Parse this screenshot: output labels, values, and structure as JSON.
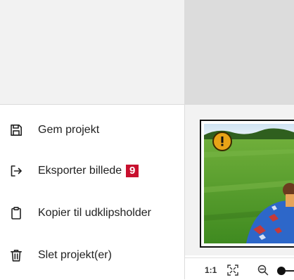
{
  "menu": {
    "items": [
      {
        "label": "Gem projekt",
        "icon": "save-icon"
      },
      {
        "label": "Eksporter billede",
        "icon": "export-icon",
        "badge": "9"
      },
      {
        "label": "Kopier til udklipsholder",
        "icon": "clipboard-icon"
      },
      {
        "label": "Slet projekt(er)",
        "icon": "trash-icon"
      }
    ]
  },
  "preview": {
    "warning_icon": "warning-icon",
    "zoom_label": "1:1",
    "fit_icon": "fit-screen-icon",
    "zoom_out_icon": "zoom-out-icon"
  },
  "colors": {
    "badge": "#c8102e",
    "warning": "#e8a317"
  }
}
